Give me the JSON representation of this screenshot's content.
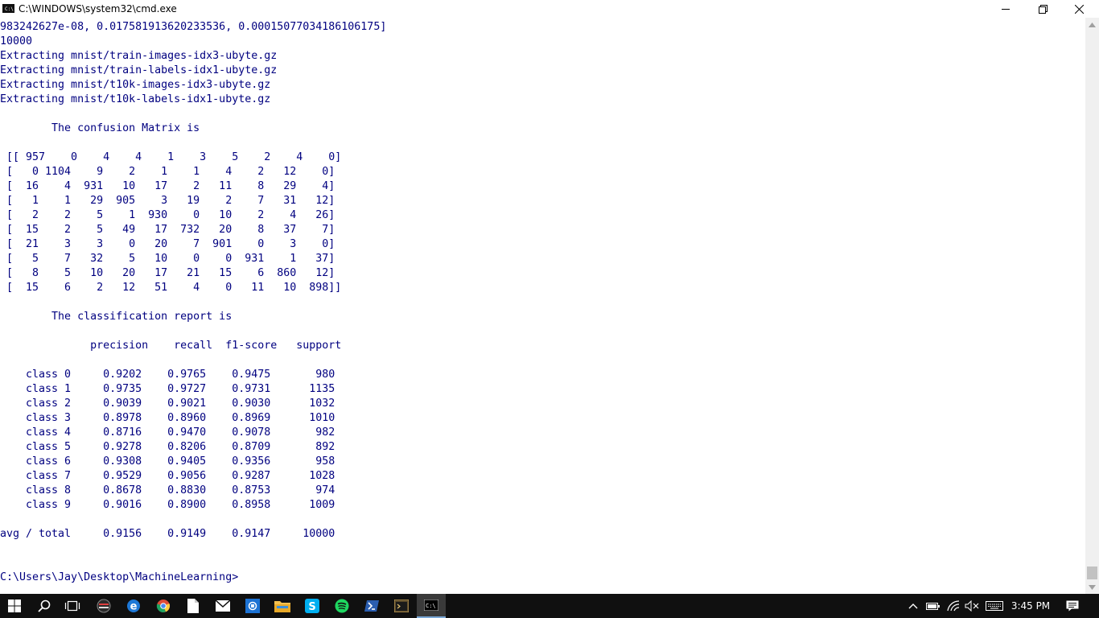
{
  "window": {
    "title": "C:\\WINDOWS\\system32\\cmd.exe",
    "icon": "cmd-icon"
  },
  "console": {
    "lines": [
      "983242627e-08, 0.017581913620233536, 0.00015077034186106175]",
      "10000",
      "Extracting mnist/train-images-idx3-ubyte.gz",
      "Extracting mnist/train-labels-idx1-ubyte.gz",
      "Extracting mnist/t10k-images-idx3-ubyte.gz",
      "Extracting mnist/t10k-labels-idx1-ubyte.gz",
      "",
      "        The confusion Matrix is",
      "",
      " [[ 957    0    4    4    1    3    5    2    4    0]",
      " [   0 1104    9    2    1    1    4    2   12    0]",
      " [  16    4  931   10   17    2   11    8   29    4]",
      " [   1    1   29  905    3   19    2    7   31   12]",
      " [   2    2    5    1  930    0   10    2    4   26]",
      " [  15    2    5   49   17  732   20    8   37    7]",
      " [  21    3    3    0   20    7  901    0    3    0]",
      " [   5    7   32    5   10    0    0  931    1   37]",
      " [   8    5   10   20   17   21   15    6  860   12]",
      " [  15    6    2   12   51    4    0   11   10  898]]",
      "",
      "        The classification report is",
      "",
      "              precision    recall  f1-score   support",
      "",
      "    class 0     0.9202    0.9765    0.9475       980",
      "    class 1     0.9735    0.9727    0.9731      1135",
      "    class 2     0.9039    0.9021    0.9030      1032",
      "    class 3     0.8978    0.8960    0.8969      1010",
      "    class 4     0.8716    0.9470    0.9078       982",
      "    class 5     0.9278    0.8206    0.8709       892",
      "    class 6     0.9308    0.9405    0.9356       958",
      "    class 7     0.9529    0.9056    0.9287      1028",
      "    class 8     0.8678    0.8830    0.8753       974",
      "    class 9     0.9016    0.8900    0.8958      1009",
      "",
      "avg / total     0.9156    0.9149    0.9147     10000",
      "",
      "",
      "C:\\Users\\Jay\\Desktop\\MachineLearning>"
    ],
    "text_color": "#000080",
    "background": "#ffffff"
  },
  "taskbar": {
    "background": "#101010",
    "pinned": [
      "start-icon",
      "search-icon",
      "task-view-icon",
      "media-app-icon",
      "edge-icon",
      "chrome-icon",
      "file-icon",
      "mail-icon",
      "blue-app-icon",
      "file-explorer-icon",
      "skype-icon",
      "spotify-icon",
      "powershell-icon",
      "terminal-app-icon",
      "cmd-icon"
    ],
    "tray": {
      "time": "3:45 PM",
      "icons": [
        "chevron-up-icon",
        "battery-icon",
        "wifi-icon",
        "volume-muted-icon",
        "keyboard-icon",
        "action-center-icon"
      ]
    }
  }
}
